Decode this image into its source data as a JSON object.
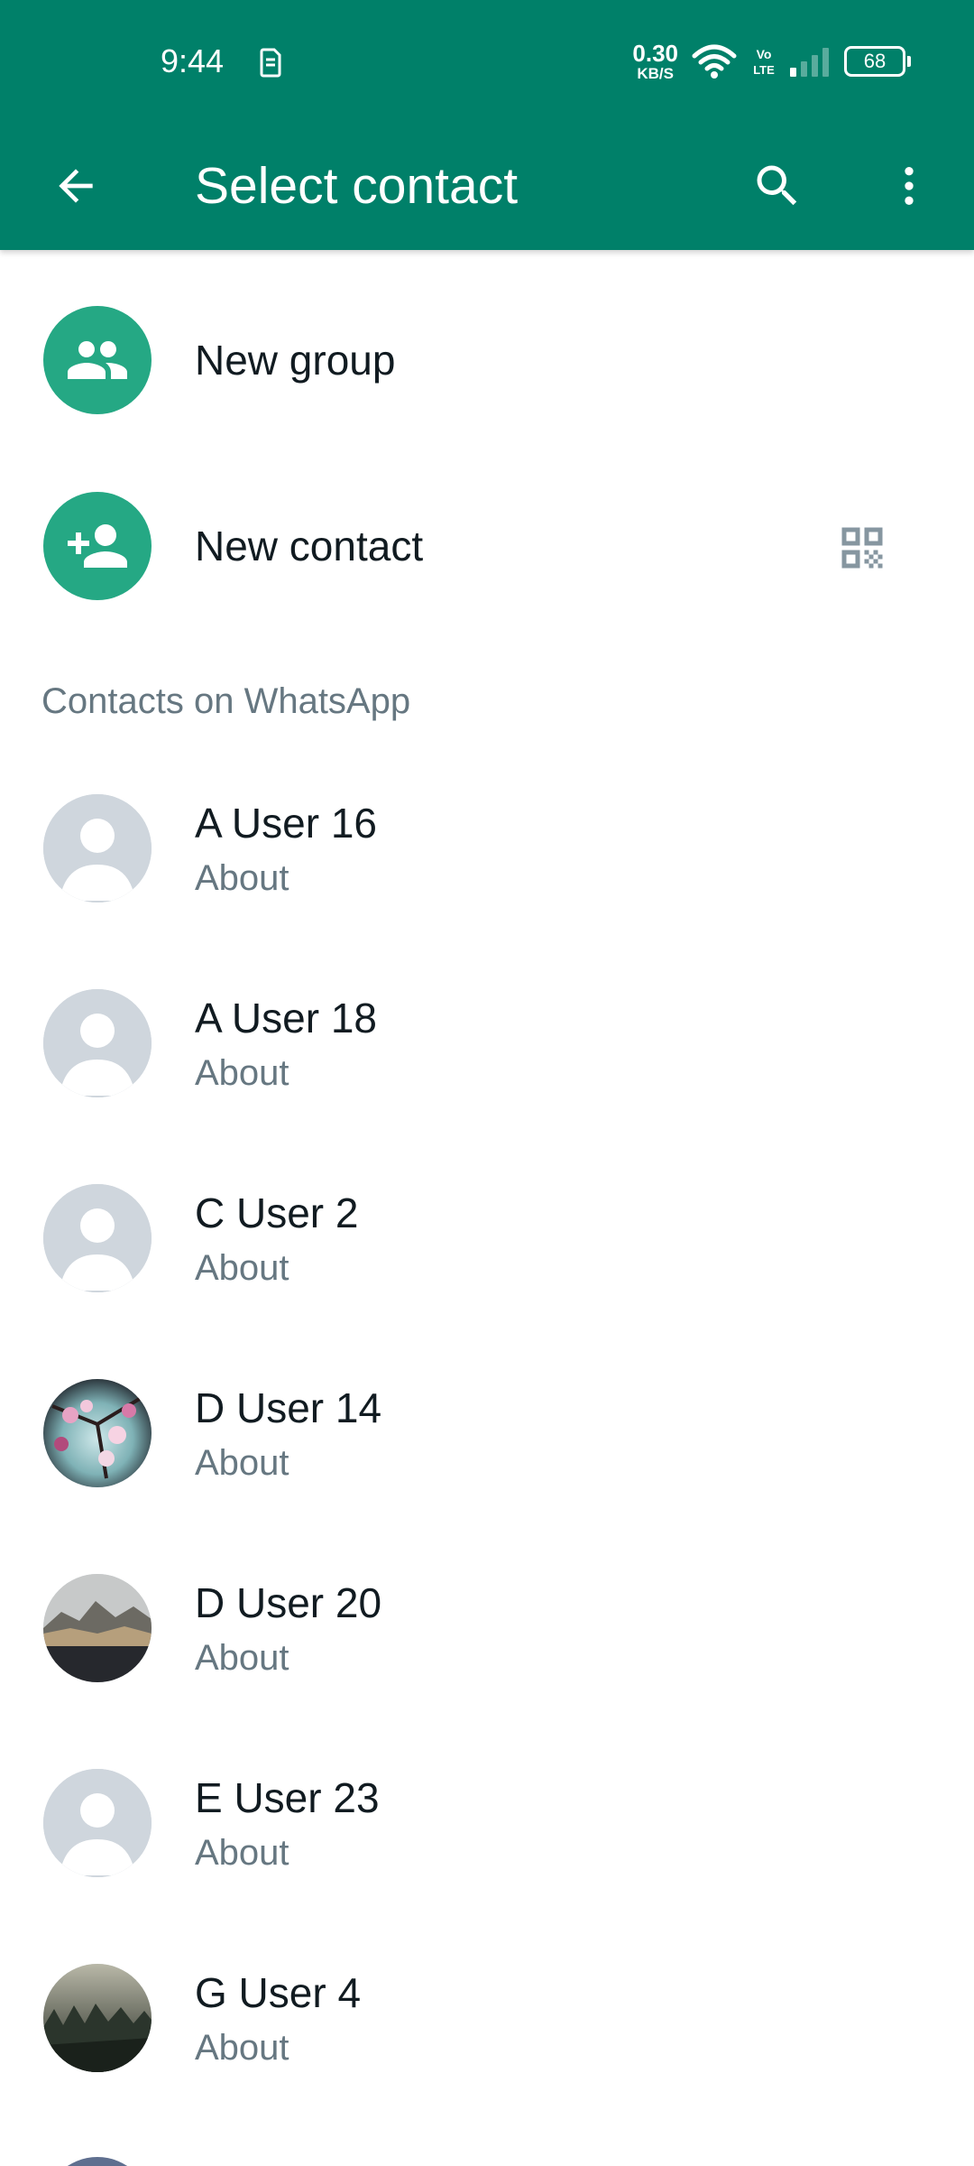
{
  "status_bar": {
    "time": "9:44",
    "net_speed_value": "0.30",
    "net_speed_unit": "KB/S",
    "battery": "68",
    "volte": "Vo LTE",
    "icons": [
      "sim-icon",
      "wifi-icon",
      "volte-icon",
      "signal-icon",
      "battery-icon"
    ]
  },
  "app_bar": {
    "title": "Select contact",
    "icons": [
      "back-arrow-icon",
      "search-icon",
      "more-vert-icon"
    ]
  },
  "actions": [
    {
      "label": "New group",
      "icon": "group-icon"
    },
    {
      "label": "New contact",
      "icon": "person-add-icon",
      "trailing_icon": "qr-code-icon"
    }
  ],
  "section_header": "Contacts on WhatsApp",
  "contacts": [
    {
      "name": "A User 16",
      "about": "About",
      "avatar": "default"
    },
    {
      "name": "A User 18",
      "about": "About",
      "avatar": "default"
    },
    {
      "name": "C User 2",
      "about": "About",
      "avatar": "default"
    },
    {
      "name": "D User 14",
      "about": "About",
      "avatar": "photo-blossom"
    },
    {
      "name": "D User 20",
      "about": "About",
      "avatar": "photo-coast"
    },
    {
      "name": "E User 23",
      "about": "About",
      "avatar": "default"
    },
    {
      "name": "G User 4",
      "about": "About",
      "avatar": "photo-forest"
    }
  ],
  "colors": {
    "primary": "#008069",
    "accent": "#25a884",
    "text_primary": "#111b21",
    "text_secondary": "#667781",
    "default_avatar_bg": "#cfd6dd"
  }
}
